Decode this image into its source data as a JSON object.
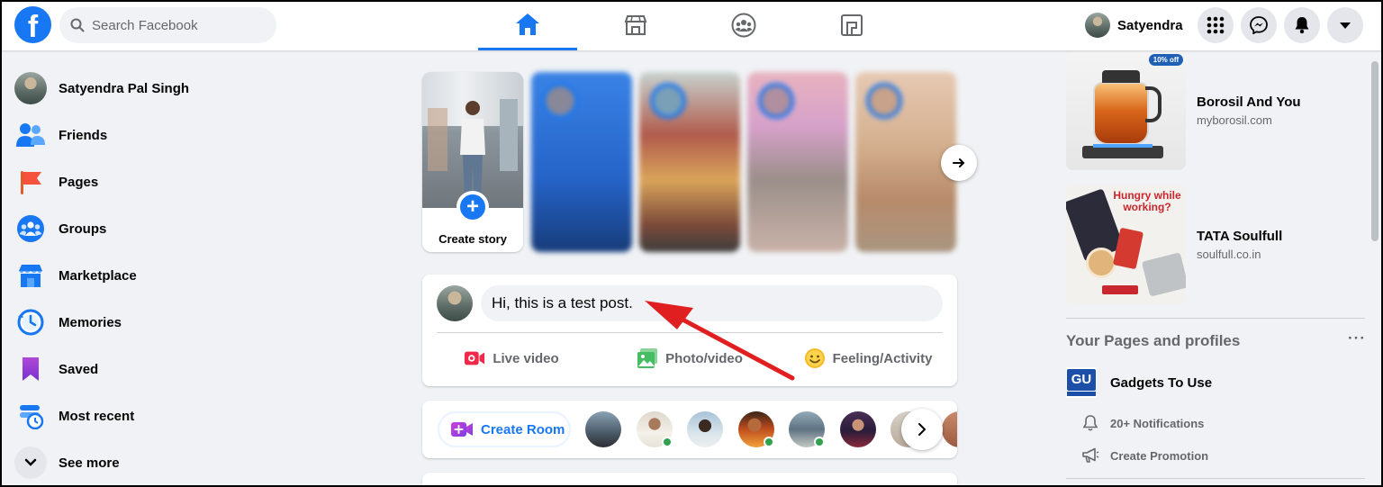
{
  "header": {
    "search_placeholder": "Search Facebook",
    "user_name": "Satyendra",
    "nav_tabs": [
      "home-icon",
      "marketplace-icon",
      "groups-icon",
      "gaming-icon"
    ],
    "active_tab": "home-icon"
  },
  "sidebar": {
    "items": [
      {
        "label": "Satyendra Pal Singh",
        "icon": "profile-avatar"
      },
      {
        "label": "Friends",
        "icon": "friends-icon"
      },
      {
        "label": "Pages",
        "icon": "pages-flag-icon"
      },
      {
        "label": "Groups",
        "icon": "groups-icon"
      },
      {
        "label": "Marketplace",
        "icon": "marketplace-icon"
      },
      {
        "label": "Memories",
        "icon": "memories-clock-icon"
      },
      {
        "label": "Saved",
        "icon": "saved-bookmark-icon"
      },
      {
        "label": "Most recent",
        "icon": "most-recent-icon"
      },
      {
        "label": "See more",
        "icon": "chevron-down-icon"
      }
    ]
  },
  "stories": {
    "create_label": "Create story"
  },
  "composer": {
    "text": "Hi, this is a test post.",
    "actions": [
      {
        "label": "Live video",
        "icon": "live-video-icon",
        "color": "#f02849"
      },
      {
        "label": "Photo/video",
        "icon": "photo-video-icon",
        "color": "#45bd62"
      },
      {
        "label": "Feeling/Activity",
        "icon": "feeling-icon",
        "color": "#f7b928"
      }
    ]
  },
  "rooms": {
    "create_label": "Create Room"
  },
  "right": {
    "ads": [
      {
        "title": "Borosil And You",
        "domain": "myborosil.com",
        "badge": "10% off"
      },
      {
        "title": "TATA Soulfull",
        "domain": "soulfull.co.in",
        "headline": "Hungry while working?"
      }
    ],
    "pages_section": {
      "title": "Your Pages and profiles",
      "more": "···",
      "page_name": "Gadgets To Use",
      "logo_text": "GU",
      "notifications": "20+ Notifications",
      "promotion": "Create Promotion"
    }
  },
  "colors": {
    "brand": "#1877f2",
    "background": "#f0f2f5",
    "secondary_text": "#65676b",
    "annotation_arrow": "#e02020"
  }
}
